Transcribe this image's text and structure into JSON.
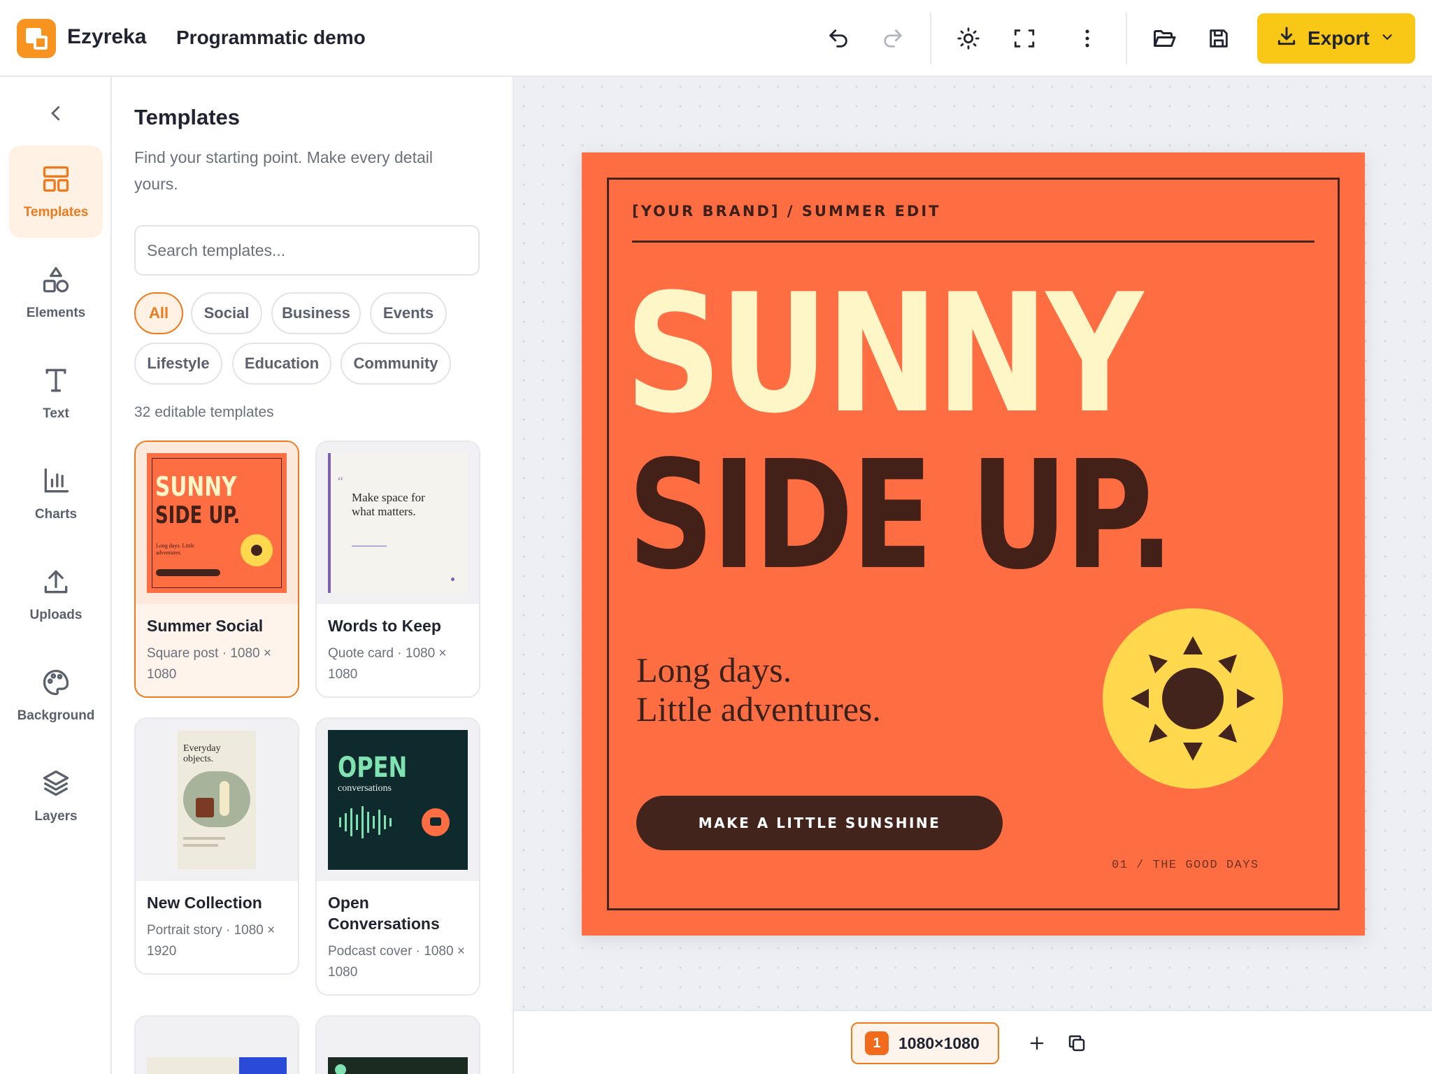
{
  "app": {
    "brand": "Ezyreka",
    "project_title": "Programmatic demo"
  },
  "toolbar": {
    "export_label": "Export",
    "icons": [
      "undo-icon",
      "redo-icon",
      "sun-icon",
      "fullscreen-icon",
      "more-vertical-icon",
      "folder-open-icon",
      "save-icon",
      "download-icon",
      "chevron-down-icon"
    ]
  },
  "rail": {
    "items": [
      {
        "label": "Templates",
        "icon": "templates-icon"
      },
      {
        "label": "Elements",
        "icon": "shapes-icon"
      },
      {
        "label": "Text",
        "icon": "text-icon"
      },
      {
        "label": "Charts",
        "icon": "bar-chart-icon"
      },
      {
        "label": "Uploads",
        "icon": "upload-icon"
      },
      {
        "label": "Background",
        "icon": "palette-icon"
      },
      {
        "label": "Layers",
        "icon": "layers-icon"
      }
    ]
  },
  "panel": {
    "title": "Templates",
    "description": "Find your starting point. Make every detail yours.",
    "search_placeholder": "Search templates...",
    "filters": [
      "All",
      "Social",
      "Business",
      "Events",
      "Lifestyle",
      "Education",
      "Community"
    ],
    "active_filter": "All",
    "count_text": "32 editable templates",
    "cards": [
      {
        "title": "Summer Social",
        "meta": "Square post · 1080 × 1080"
      },
      {
        "title": "Words to Keep",
        "meta": "Quote card · 1080 × 1080"
      },
      {
        "title": "New Collection",
        "meta": "Portrait story · 1080 × 1920"
      },
      {
        "title": "Open Conversations",
        "meta": "Podcast cover · 1080 × 1080"
      }
    ],
    "thumbs": {
      "summer": {
        "h1": "SUNNY",
        "h2": "SIDE UP.",
        "sub": "Long days. Little adventures."
      },
      "quote": {
        "text": "Make space for what matters."
      },
      "collection": {
        "text": "Everyday objects."
      },
      "podcast": {
        "h1": "OPEN",
        "sub": "conversations"
      }
    }
  },
  "artboard": {
    "brand_line": "[YOUR BRAND] / SUMMER EDIT",
    "headline_1": "SUNNY",
    "headline_2": "SIDE UP.",
    "sub_1": "Long days.",
    "sub_2": "Little adventures.",
    "cta": "MAKE A LITTLE SUNSHINE",
    "footer": "01 / THE GOOD DAYS",
    "colors": {
      "background": "#ff6d42",
      "cream": "#fff6c8",
      "brown": "#43241c",
      "sun": "#ffd84d"
    }
  },
  "bottombar": {
    "page_number": "1",
    "page_size": "1080×1080"
  },
  "colors": {
    "accent": "#ee7a1e",
    "export": "#f9c716"
  }
}
